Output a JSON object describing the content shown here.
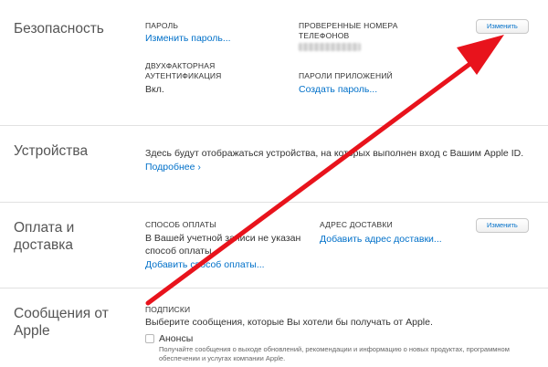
{
  "security": {
    "title": "Безопасность",
    "password_label": "ПАРОЛЬ",
    "change_password_link": "Изменить пароль...",
    "phones_label_line1": "ПРОВЕРЕННЫЕ НОМЕРА",
    "phones_label_line2": "ТЕЛЕФОНОВ",
    "two_factor_label_line1": "ДВУХФАКТОРНАЯ",
    "two_factor_label_line2": "АУТЕНТИФИКАЦИЯ",
    "two_factor_value": "Вкл.",
    "app_passwords_label": "ПАРОЛИ ПРИЛОЖЕНИЙ",
    "create_password_link": "Создать пароль...",
    "edit_button": "Изменить"
  },
  "devices": {
    "title": "Устройства",
    "description": "Здесь будут отображаться устройства, на которых выполнен вход с Вашим Apple ID.",
    "more_link": "Подробнее ›"
  },
  "payment": {
    "title_line1": "Оплата и",
    "title_line2": "доставка",
    "method_label": "СПОСОБ ОПЛАТЫ",
    "method_line1": "В Вашей учетной записи не указан",
    "method_line2": "способ оплаты.",
    "add_method_link": "Добавить способ оплаты...",
    "address_label": "АДРЕС ДОСТАВКИ",
    "add_address_link": "Добавить адрес доставки...",
    "edit_button": "Изменить"
  },
  "messages": {
    "title_line1": "Сообщения от",
    "title_line2": "Apple",
    "subscriptions_label": "ПОДПИСКИ",
    "subscriptions_text": "Выберите сообщения, которые Вы хотели бы получать от Apple.",
    "announcements_label": "Анонсы",
    "announcements_desc_line1": "Получайте сообщения о выходе обновлений, рекомендации и информацию о новых продуктах, программном",
    "announcements_desc_line2": "обеспечении и услугах компании Apple."
  },
  "colors": {
    "link": "#0070c9",
    "annotation_arrow": "#e8131c"
  },
  "annotation": {
    "icon": "red-arrow-icon"
  }
}
